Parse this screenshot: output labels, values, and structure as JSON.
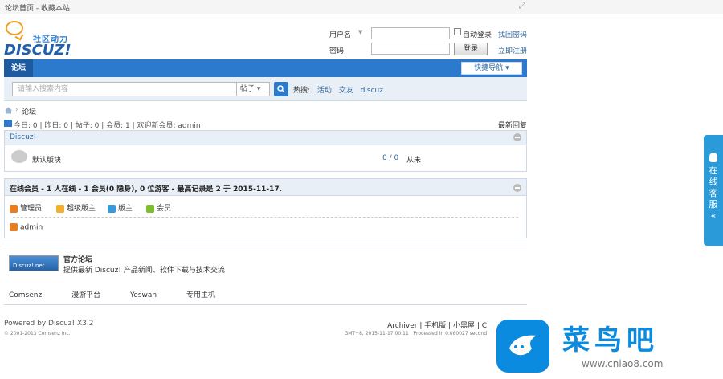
{
  "window": {
    "title": "论坛首页 - 收藏本站"
  },
  "logo": {
    "cn": "社区动力",
    "en": "DISCUZ!"
  },
  "login": {
    "username_label": "用户名",
    "password_label": "密码",
    "auto_login": "自动登录",
    "login_button": "登录",
    "find_password": "找回密码",
    "register": "立即注册"
  },
  "nav": {
    "tab": "论坛",
    "quick_nav": "快捷导航 ▾"
  },
  "search": {
    "placeholder": "请输入搜索内容",
    "type": "帖子",
    "hot_label": "热搜:",
    "hot": [
      "活动",
      "交友",
      "discuz"
    ]
  },
  "breadcrumb": {
    "current": "论坛"
  },
  "stats": {
    "text": "今日: 0 | 昨日: 0 | 帖子: 0 | 会员: 1 | 欢迎新会员: admin",
    "right": "最新回复"
  },
  "forum_group": {
    "title": "Discuz!",
    "forums": [
      {
        "name": "默认版块",
        "count": "0 / 0",
        "last": "从未"
      }
    ]
  },
  "online": {
    "title": "在线会员 - 1 人在线 - 1 会员(0 隐身), 0 位游客 - 最高记录是 2 于 2015-11-17.",
    "legend": [
      {
        "label": "管理员",
        "color": "#e67e22"
      },
      {
        "label": "超级版主",
        "color": "#f0b030"
      },
      {
        "label": "版主",
        "color": "#3a9ad9"
      },
      {
        "label": "会员",
        "color": "#7cbf2a"
      }
    ],
    "users": [
      "admin"
    ]
  },
  "links": {
    "banner": "Discuz!.net",
    "title": "官方论坛",
    "desc": "提供最新 Discuz! 产品新闻、软件下载与技术交流",
    "items": [
      "Comsenz",
      "漫游平台",
      "Yeswan",
      "专用主机"
    ]
  },
  "footer": {
    "powered": "Powered by Discuz! X3.2",
    "copy": "© 2001-2013 Comsenz Inc.",
    "links": "Archiver | 手机版 | 小黑屋 | C",
    "gmt": "GMT+8, 2015-11-17 00:11 , Processed in 0.080027 second"
  },
  "service": {
    "text": "在线客服 «"
  },
  "watermark": {
    "cn": "菜鸟吧",
    "url": "www.cniao8.com"
  }
}
